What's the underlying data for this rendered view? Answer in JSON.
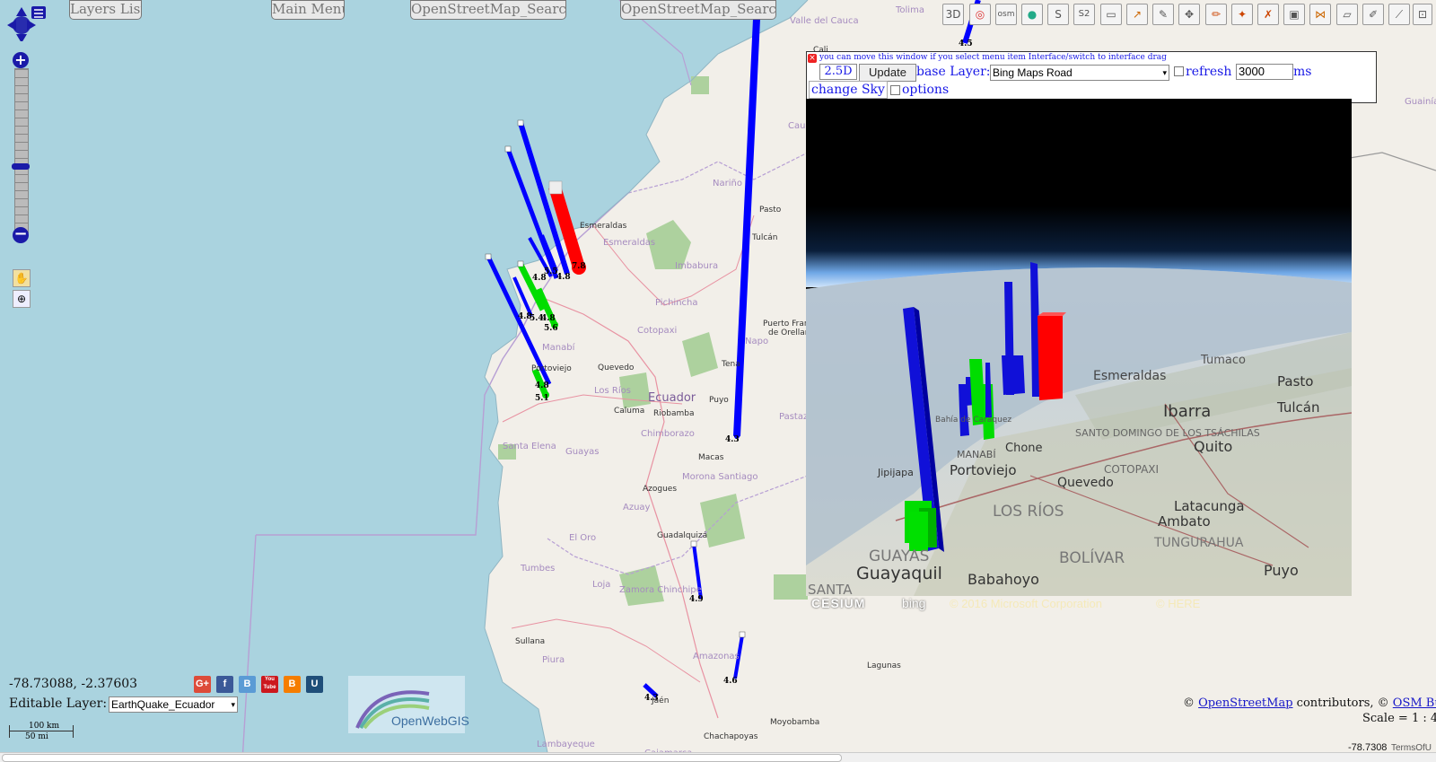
{
  "top_buttons": [
    "Layers List",
    "Main Menu",
    "OpenStreetMap_Search:",
    "OpenStreetMap_Search:"
  ],
  "toolbar": [
    "3D",
    "osm",
    "globe",
    "S",
    "S2",
    "ruler",
    "path",
    "pen",
    "move",
    "pencil",
    "edit",
    "erase",
    "save",
    "nodes",
    "area",
    "draw",
    "line",
    "more"
  ],
  "place_labels": [
    {
      "text": "Esmeraldas",
      "size": 8
    },
    {
      "text": "Esmeraldas",
      "size": 10
    },
    {
      "text": "Manabí",
      "size": 10
    },
    {
      "text": "Portoviejo",
      "size": 8
    },
    {
      "text": "Quevedo",
      "size": 8
    },
    {
      "text": "Los Ríos",
      "size": 10
    },
    {
      "text": "Caluma",
      "size": 8
    },
    {
      "text": "Ecuador",
      "size": 13
    },
    {
      "text": "Riobamba",
      "size": 8
    },
    {
      "text": "Chimborazo",
      "size": 10
    },
    {
      "text": "Guayas",
      "size": 10
    },
    {
      "text": "Santa Elena",
      "size": 10
    },
    {
      "text": "Macas",
      "size": 8
    },
    {
      "text": "Morona Santiago",
      "size": 10
    },
    {
      "text": "Azogues",
      "size": 8
    },
    {
      "text": "Azuay",
      "size": 10
    },
    {
      "text": "El Oro",
      "size": 10
    },
    {
      "text": "Guadalquizá",
      "size": 8
    },
    {
      "text": "Tumbes",
      "size": 10
    },
    {
      "text": "Loja",
      "size": 10
    },
    {
      "text": "Zamora Chinchipe",
      "size": 10
    },
    {
      "text": "Sullana",
      "size": 8
    },
    {
      "text": "Piura",
      "size": 10
    },
    {
      "text": "Amazonas",
      "size": 10
    },
    {
      "text": "Lagunas",
      "size": 8
    },
    {
      "text": "Jaén",
      "size": 8
    },
    {
      "text": "Chachapoyas",
      "size": 8
    },
    {
      "text": "Moyobamba",
      "size": 8
    },
    {
      "text": "Lambayeque",
      "size": 10
    },
    {
      "text": "Cajamarca",
      "size": 10
    },
    {
      "text": "Imbabura",
      "size": 10
    },
    {
      "text": "Pichincha",
      "size": 10
    },
    {
      "text": "Cotopaxi",
      "size": 10
    },
    {
      "text": "Puyo",
      "size": 8
    },
    {
      "text": "Tena",
      "size": 8
    },
    {
      "text": "Napo",
      "size": 10
    },
    {
      "text": "Pastaza",
      "size": 10
    },
    {
      "text": "Puerto Francisco",
      "size": 8
    },
    {
      "text": "de Orellana",
      "size": 8
    },
    {
      "text": "Nariño",
      "size": 10
    },
    {
      "text": "Pasto",
      "size": 8
    },
    {
      "text": "Tulcán",
      "size": 8
    },
    {
      "text": "Cauca",
      "size": 10
    },
    {
      "text": "Valle del Cauca",
      "size": 10
    },
    {
      "text": "Tolima",
      "size": 10
    },
    {
      "text": "Cali",
      "size": 8
    },
    {
      "text": "Guainía",
      "size": 10
    }
  ],
  "magnitudes": [
    "4.5",
    "4.8",
    "5.5",
    "7.8",
    "4.8",
    "4.8",
    "5.4",
    "4.8",
    "5.6",
    "4.8",
    "5.1",
    "4.3",
    "4.9",
    "4.6",
    "4.3",
    "4.5"
  ],
  "viewer": {
    "hint": "you can move this window if you select menu item Interface/switch to interface drag",
    "mode_value": "2.5D",
    "update_label": "Update",
    "base_layer_label": "base Layer:",
    "base_layer_value": "Bing Maps Road",
    "refresh_label": "refresh",
    "refresh_value": "3000",
    "ms_label": "ms",
    "change_sky_label": "change Sky",
    "options_label": "options"
  },
  "globe_labels": [
    "Tumaco",
    "Esmeraldas",
    "Ibarra",
    "Pasto",
    "Tulcán",
    "Quito",
    "Chone",
    "Portoviejo",
    "Jipijapa",
    "MANABÍ",
    "Bahía de Caráquez",
    "Quevedo",
    "SANTO DOMINGO DE LOS TSÁCHILAS",
    "COTOPAXI",
    "LOS RÍOS",
    "Latacunga",
    "Ambato",
    "TUNGURAHUA",
    "BOLÍVAR",
    "GUAYAS",
    "Guayaquil",
    "Babahoyo",
    "Puyo",
    "SANTA"
  ],
  "globe_credit": "© 2016 Microsoft Corporation",
  "globe_credit2": "© HERE",
  "cesium_label": "CESIUM",
  "bing_label": "bing",
  "coords": "-78.73088, -2.37603",
  "editable_label": "Editable Layer:",
  "editable_value": "EarthQuake_Ecuador",
  "scale_km": "100 km",
  "scale_mi": "50 mi",
  "logo_text": "OpenWebGIS",
  "attribution_prefix": "©",
  "attribution_osm": "OpenStreetMap",
  "attribution_mid": "contributors, ©",
  "attribution_osmb": "OSM Building",
  "scale_text": "Scale = 1 : 4",
  "bottom_coords": "-78.7308",
  "terms": "TermsOfU",
  "social_icons": [
    "G+",
    "f",
    "B",
    "You Tube",
    "B",
    "U"
  ]
}
